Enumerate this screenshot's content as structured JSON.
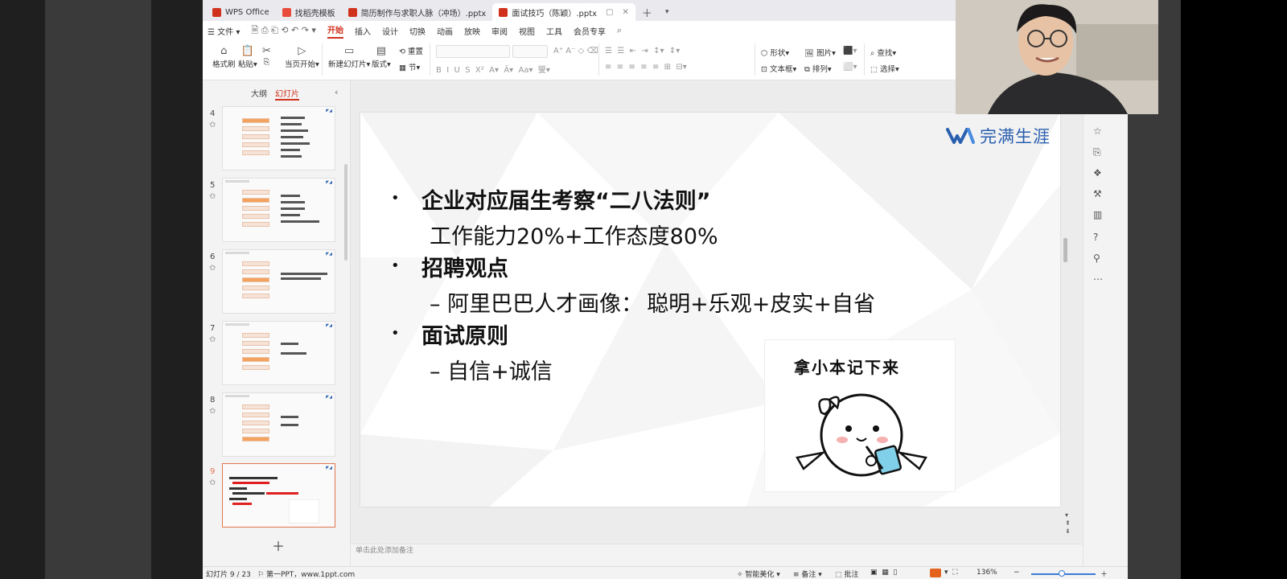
{
  "tabs": [
    {
      "label": "WPS Office",
      "color": "#d0311c",
      "active": false
    },
    {
      "label": "找稻壳模板",
      "color": "#e84b3c",
      "active": false
    },
    {
      "label": "简历制作与求职人脉（冲场）.pptx",
      "color": "#d0311c",
      "active": false
    },
    {
      "label": "面试技巧（陈颖）.pptx",
      "color": "#d0311c",
      "active": true
    }
  ],
  "menu": {
    "file": "文件",
    "items": [
      "开始",
      "插入",
      "设计",
      "切换",
      "动画",
      "放映",
      "审阅",
      "视图",
      "工具",
      "会员专享"
    ],
    "active": "开始"
  },
  "ribbon": {
    "format_painter": "格式刷",
    "paste": "粘贴",
    "from_current": "当页开始",
    "new_slide": "新建幻灯片",
    "layout": "版式",
    "section": "节",
    "reset": "重置",
    "shape": "形状",
    "picture": "图片",
    "textbox": "文本框",
    "arrange": "排列",
    "find": "查找",
    "select": "选择"
  },
  "left_panel": {
    "tab_outline": "大纲",
    "tab_slides": "幻灯片",
    "thumbnails": [
      {
        "num": "4"
      },
      {
        "num": "5"
      },
      {
        "num": "6"
      },
      {
        "num": "7"
      },
      {
        "num": "8"
      },
      {
        "num": "9",
        "selected": true
      }
    ]
  },
  "slide": {
    "brand": "完满生涯",
    "bullet1": "企业对应届生考察“二八法则”",
    "bullet1_sub": "工作能力20%+工作态度80%",
    "bullet2": "招聘观点",
    "bullet2_sub_prefix": "阿里巴巴人才画像：",
    "bullet2_sub_red": "聪明+乐观+皮实+自省",
    "bullet3": "面试原则",
    "bullet3_sub": "自信+诚信",
    "memo_title": "拿小本记下来"
  },
  "notes_placeholder": "单击此处添加备注",
  "status": {
    "slide_count": "幻灯片 9 / 23",
    "theme": "第一PPT，www.1ppt.com",
    "beautify": "智能美化",
    "notes": "备注",
    "comment": "批注",
    "zoom": "136%"
  },
  "colors": {
    "accent": "#d0311c",
    "highlight_red": "#e02020",
    "brand_blue": "#2a5fb0"
  }
}
